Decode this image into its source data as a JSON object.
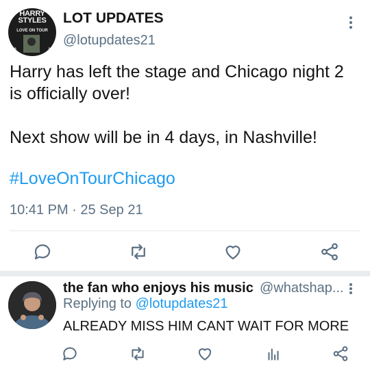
{
  "tweet": {
    "avatar": {
      "line1": "HARRY",
      "line2": "STYLES",
      "line3": "LOVE ON TOUR",
      "year_left": "20",
      "year_right": "21"
    },
    "display_name": "LOT UPDATES",
    "handle": "@lotupdates21",
    "body_line1": "Harry has left the stage and Chicago night 2 is officially over!",
    "body_line2": "Next show will be in 4 days, in Nashville!",
    "hashtag": "#LoveOnTourChicago",
    "timestamp": "10:41 PM · 25 Sep 21",
    "actions": [
      {
        "name": "reply",
        "icon": "speech-bubble-icon"
      },
      {
        "name": "retweet",
        "icon": "retweet-icon"
      },
      {
        "name": "like",
        "icon": "heart-icon"
      },
      {
        "name": "share",
        "icon": "share-icon"
      }
    ]
  },
  "reply": {
    "display_name": "the fan who enjoys his music",
    "handle": "@whatshap...",
    "replying_prefix": "Replying to",
    "replying_to": "@lotupdates21",
    "text": "ALREADY MISS HIM CANT WAIT FOR MORE",
    "actions": [
      {
        "name": "reply",
        "icon": "speech-bubble-icon"
      },
      {
        "name": "retweet",
        "icon": "retweet-icon"
      },
      {
        "name": "like",
        "icon": "heart-icon"
      },
      {
        "name": "analytics",
        "icon": "bar-chart-icon"
      },
      {
        "name": "share",
        "icon": "share-icon"
      }
    ]
  },
  "colors": {
    "link": "#1d9bf0",
    "muted": "#5b7083",
    "text": "#141414",
    "divider": "#e1e8ed"
  }
}
